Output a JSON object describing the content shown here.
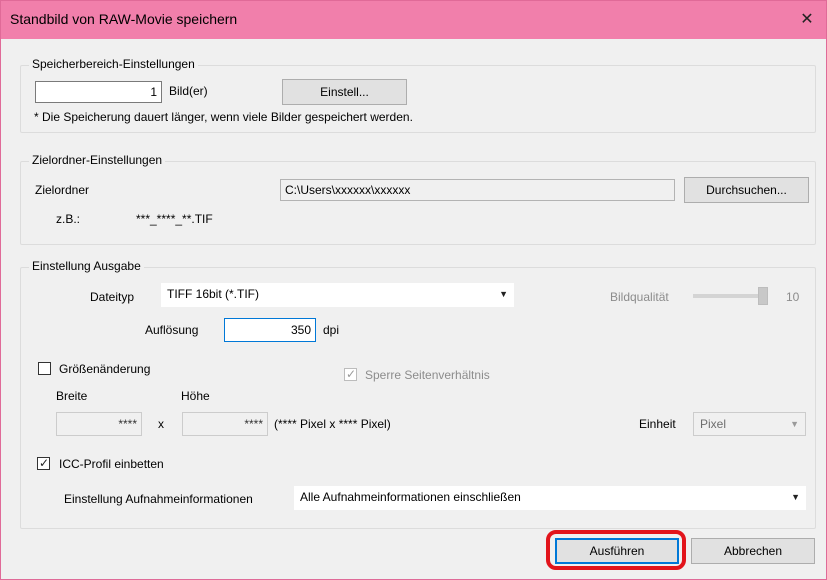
{
  "window": {
    "title": "Standbild von RAW-Movie speichern",
    "close_glyph": "✕"
  },
  "save_range": {
    "group_title": "Speicherbereich-Einstellungen",
    "count_value": "1",
    "count_unit": "Bild(er)",
    "settings_button": "Einstell...",
    "note": "* Die Speicherung dauert länger, wenn viele Bilder gespeichert werden."
  },
  "destination": {
    "group_title": "Zielordner-Einstellungen",
    "folder_label": "Zielordner",
    "folder_path": "C:\\Users\\xxxxxx\\xxxxxx",
    "browse_button": "Durchsuchen...",
    "example_label": "z.B.:",
    "example_value": "***_****_**.TIF"
  },
  "output": {
    "group_title": "Einstellung Ausgabe",
    "file_type_label": "Dateityp",
    "file_type_value": "TIFF 16bit (*.TIF)",
    "quality_label": "Bildqualität",
    "quality_value": "10",
    "quality_level": 1.0,
    "resolution_label": "Auflösung",
    "resolution_value": "350",
    "resolution_unit": "dpi",
    "resize_label": "Größenänderung",
    "resize_checked": false,
    "lock_ratio_label": "Sperre Seitenverhältnis",
    "lock_ratio_checked": true,
    "width_label": "Breite",
    "height_label": "Höhe",
    "width_value": "****",
    "height_value": "****",
    "times_sign": "x",
    "size_summary": "(**** Pixel x **** Pixel)",
    "unit_label": "Einheit",
    "unit_value": "Pixel",
    "icc_label": "ICC-Profil einbetten",
    "icc_checked": true,
    "shooting_info_label": "Einstellung Aufnahmeinformationen",
    "shooting_info_value": "Alle Aufnahmeinformationen einschließen"
  },
  "buttons": {
    "execute": "Ausführen",
    "cancel": "Abbrechen"
  },
  "colors": {
    "titlebar": "#f17fab",
    "highlight": "#e2141b",
    "focus": "#0078d7"
  }
}
